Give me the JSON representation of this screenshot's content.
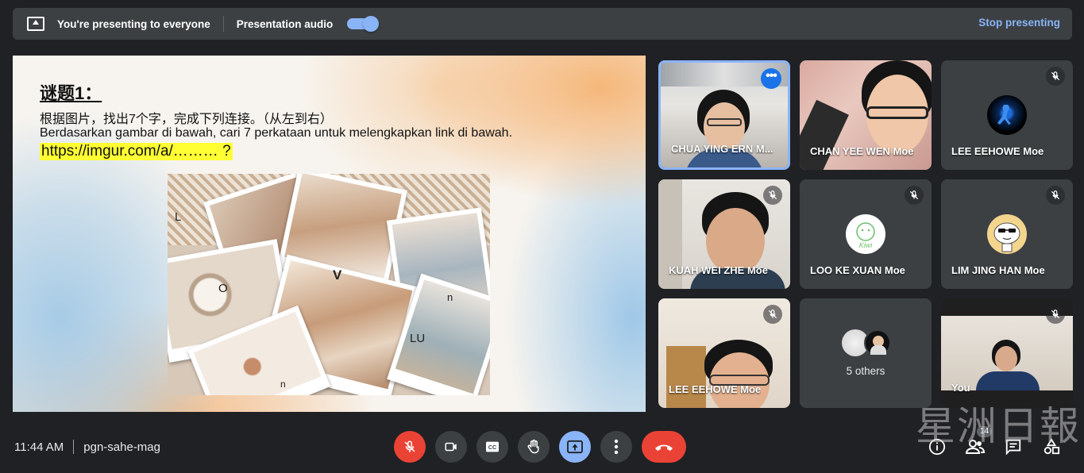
{
  "topbar": {
    "presenting_text": "You're presenting to everyone",
    "audio_label": "Presentation audio",
    "audio_enabled": true,
    "stop_label": "Stop presenting"
  },
  "slide": {
    "title": "谜题1：",
    "line1": "根据图片，找出7个字，完成下列连接。（从左到右）",
    "line2": "Berdasarkan gambar di bawah, cari 7 perkataan untuk melengkapkan link di bawah.",
    "link": "https://imgur.com/a/……… ?",
    "collage_letters": [
      "L",
      "O",
      "V",
      "n",
      "LU",
      "n"
    ]
  },
  "participants": [
    {
      "name": "CHUA YING ERN M...",
      "muted": false,
      "has_video": true
    },
    {
      "name": "CHAN YEE WEN Moe",
      "muted": false,
      "has_video": true
    },
    {
      "name": "LEE EEHOWE Moe",
      "muted": true,
      "has_video": false
    },
    {
      "name": "KUAH WEI ZHE Moe",
      "muted": true,
      "has_video": true
    },
    {
      "name": "LOO KE XUAN Moe",
      "muted": true,
      "has_video": false
    },
    {
      "name": "LIM JING HAN Moe",
      "muted": true,
      "has_video": false
    },
    {
      "name": "LEE EEHOWE Moe",
      "muted": true,
      "has_video": true
    },
    {
      "name": "You",
      "muted": true,
      "has_video": true
    }
  ],
  "others_tile": {
    "label": "5 others"
  },
  "avatars": {
    "loo_ke_xuan_text": "Kiwi"
  },
  "bottombar": {
    "time": "11:44 AM",
    "meeting_code": "pgn-sahe-mag",
    "participant_count": "14"
  },
  "watermark": "星洲日報",
  "colors": {
    "accent": "#8ab4f8",
    "danger": "#ea4335",
    "bar": "#3c4043",
    "bg": "#202124"
  }
}
